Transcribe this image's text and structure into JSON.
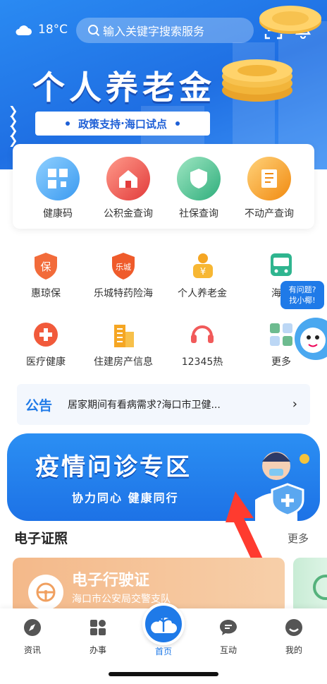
{
  "status": {
    "weather_temp": "18°C"
  },
  "search": {
    "placeholder": "输入关键字搜索服务"
  },
  "hero": {
    "title": "个人养老金",
    "subtitle_left": "政策支持",
    "subtitle_sep": "·",
    "subtitle_right": "海口试点"
  },
  "quick": [
    {
      "label": "健康码",
      "icon": "health-code-icon",
      "color": "#4fa8ef"
    },
    {
      "label": "公积金查询",
      "icon": "housing-fund-icon",
      "color": "#e84a4a"
    },
    {
      "label": "社保查询",
      "icon": "social-security-icon",
      "color": "#3db98a"
    },
    {
      "label": "不动产查询",
      "icon": "real-estate-icon",
      "color": "#f59a1c"
    }
  ],
  "services": [
    {
      "label": "惠琼保",
      "icon": "shield-bao-icon"
    },
    {
      "label": "乐城特药险海",
      "icon": "shield-lecheng-icon"
    },
    {
      "label": "个人养老金",
      "icon": "pension-icon"
    },
    {
      "label": "海口",
      "icon": "bus-icon"
    },
    {
      "label": "医疗健康",
      "icon": "medical-cross-icon"
    },
    {
      "label": "住建房产信息",
      "icon": "building-icon"
    },
    {
      "label": "12345热",
      "icon": "headset-icon"
    },
    {
      "label": "更多",
      "icon": "more-grid-icon"
    }
  ],
  "assistant": {
    "bubble_line1": "有问题?",
    "bubble_line2": "找小椰!"
  },
  "notice": {
    "tag": "公告",
    "text": "居家期间有看病需求?海口市卫健...",
    "arrow": "›"
  },
  "banner": {
    "title": "疫情问诊专区",
    "subtitle": "协力同心 健康同行"
  },
  "certs": {
    "section_title": "电子证照",
    "more": "更多",
    "card_title": "电子行驶证",
    "card_sub": "海口市公安局交警支队"
  },
  "tabs": [
    {
      "label": "资讯",
      "icon": "compass-icon"
    },
    {
      "label": "办事",
      "icon": "apps-icon"
    },
    {
      "label": "首页",
      "icon": "palm-cloud-icon"
    },
    {
      "label": "互动",
      "icon": "chat-icon"
    },
    {
      "label": "我的",
      "icon": "user-smile-icon"
    }
  ],
  "colors": {
    "brand": "#1f7ae8",
    "accent_red": "#ff3b2f",
    "notice_tag": "#1f7ae8"
  }
}
